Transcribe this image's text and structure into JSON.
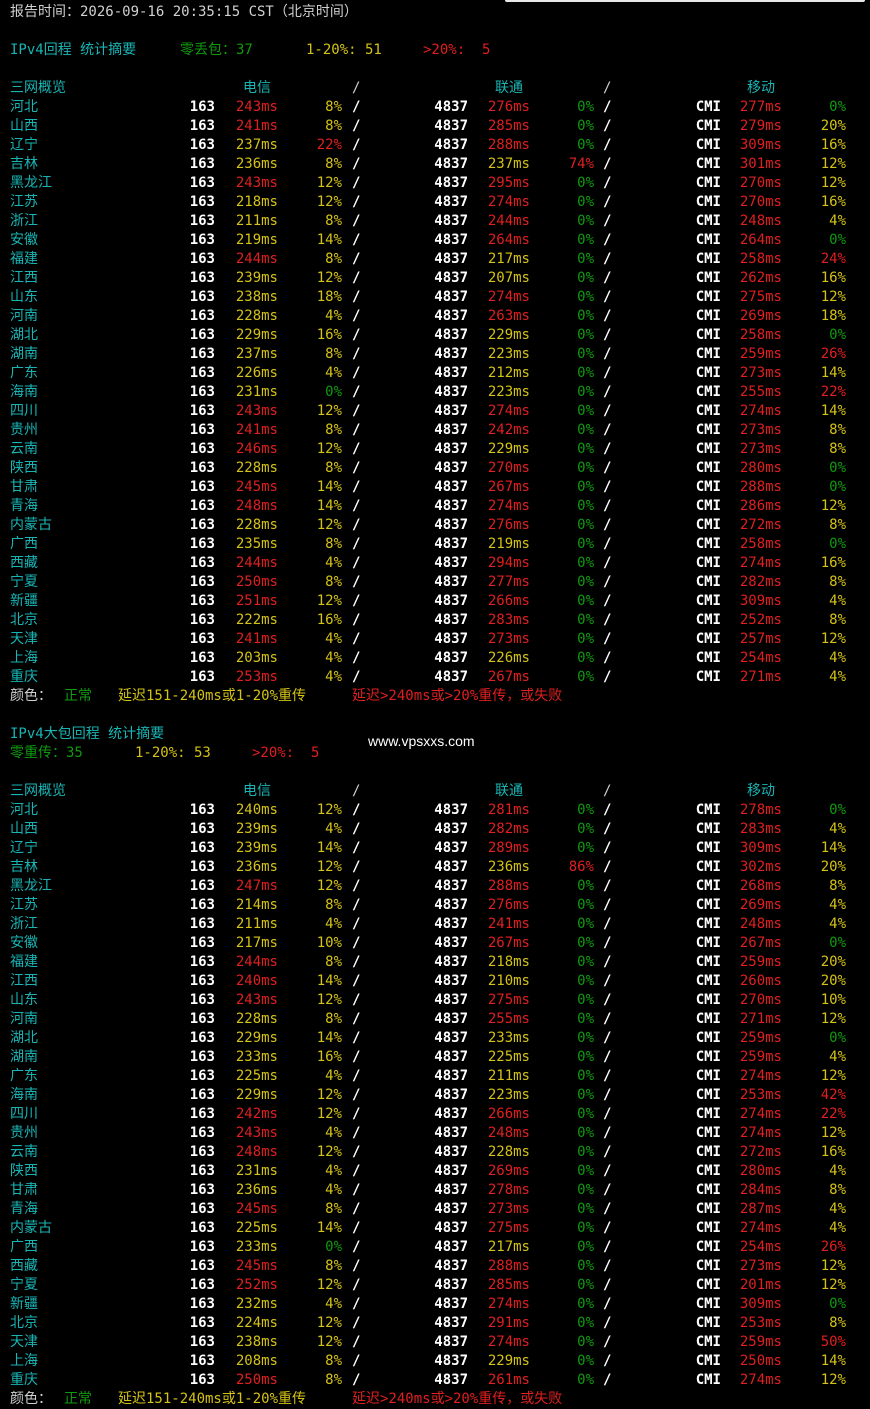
{
  "report_time": "报告时间：2026-09-16 20:35:15 CST（北京时间）",
  "watermark": "www.vpsxxs.com",
  "sections": [
    {
      "title": "IPv4回程 统计摘要",
      "summary": [
        {
          "text": "零丢包：37",
          "color": "green"
        },
        {
          "text": "1-20%: 51",
          "color": "yellow"
        },
        {
          "text": ">20%:  5",
          "color": "red"
        }
      ],
      "header": {
        "name": "三网概览",
        "ct": "电信",
        "cu": "联通",
        "cm": "移动",
        "sep": "/"
      },
      "rows": [
        [
          "河北",
          "163",
          "243ms",
          "r",
          "8%",
          "y",
          "4837",
          "276ms",
          "r",
          "0%",
          "g",
          "CMI",
          "277ms",
          "r",
          "0%",
          "g"
        ],
        [
          "山西",
          "163",
          "241ms",
          "r",
          "8%",
          "y",
          "4837",
          "285ms",
          "r",
          "0%",
          "g",
          "CMI",
          "279ms",
          "r",
          "20%",
          "y"
        ],
        [
          "辽宁",
          "163",
          "237ms",
          "y",
          "22%",
          "r",
          "4837",
          "288ms",
          "r",
          "0%",
          "g",
          "CMI",
          "309ms",
          "r",
          "16%",
          "y"
        ],
        [
          "吉林",
          "163",
          "236ms",
          "y",
          "8%",
          "y",
          "4837",
          "237ms",
          "y",
          "74%",
          "r",
          "CMI",
          "301ms",
          "r",
          "12%",
          "y"
        ],
        [
          "黑龙江",
          "163",
          "243ms",
          "r",
          "12%",
          "y",
          "4837",
          "295ms",
          "r",
          "0%",
          "g",
          "CMI",
          "270ms",
          "r",
          "12%",
          "y"
        ],
        [
          "江苏",
          "163",
          "218ms",
          "y",
          "12%",
          "y",
          "4837",
          "274ms",
          "r",
          "0%",
          "g",
          "CMI",
          "270ms",
          "r",
          "16%",
          "y"
        ],
        [
          "浙江",
          "163",
          "211ms",
          "y",
          "8%",
          "y",
          "4837",
          "244ms",
          "r",
          "0%",
          "g",
          "CMI",
          "248ms",
          "r",
          "4%",
          "y"
        ],
        [
          "安徽",
          "163",
          "219ms",
          "y",
          "14%",
          "y",
          "4837",
          "264ms",
          "r",
          "0%",
          "g",
          "CMI",
          "264ms",
          "r",
          "0%",
          "g"
        ],
        [
          "福建",
          "163",
          "244ms",
          "r",
          "8%",
          "y",
          "4837",
          "217ms",
          "y",
          "0%",
          "g",
          "CMI",
          "258ms",
          "r",
          "24%",
          "r"
        ],
        [
          "江西",
          "163",
          "239ms",
          "y",
          "12%",
          "y",
          "4837",
          "207ms",
          "y",
          "0%",
          "g",
          "CMI",
          "262ms",
          "r",
          "16%",
          "y"
        ],
        [
          "山东",
          "163",
          "238ms",
          "y",
          "18%",
          "y",
          "4837",
          "274ms",
          "r",
          "0%",
          "g",
          "CMI",
          "275ms",
          "r",
          "12%",
          "y"
        ],
        [
          "河南",
          "163",
          "228ms",
          "y",
          "4%",
          "y",
          "4837",
          "263ms",
          "r",
          "0%",
          "g",
          "CMI",
          "269ms",
          "r",
          "18%",
          "y"
        ],
        [
          "湖北",
          "163",
          "229ms",
          "y",
          "16%",
          "y",
          "4837",
          "229ms",
          "y",
          "0%",
          "g",
          "CMI",
          "258ms",
          "r",
          "0%",
          "g"
        ],
        [
          "湖南",
          "163",
          "237ms",
          "y",
          "8%",
          "y",
          "4837",
          "223ms",
          "y",
          "0%",
          "g",
          "CMI",
          "259ms",
          "r",
          "26%",
          "r"
        ],
        [
          "广东",
          "163",
          "226ms",
          "y",
          "4%",
          "y",
          "4837",
          "212ms",
          "y",
          "0%",
          "g",
          "CMI",
          "273ms",
          "r",
          "14%",
          "y"
        ],
        [
          "海南",
          "163",
          "231ms",
          "y",
          "0%",
          "g",
          "4837",
          "223ms",
          "y",
          "0%",
          "g",
          "CMI",
          "255ms",
          "r",
          "22%",
          "r"
        ],
        [
          "四川",
          "163",
          "243ms",
          "r",
          "12%",
          "y",
          "4837",
          "274ms",
          "r",
          "0%",
          "g",
          "CMI",
          "274ms",
          "r",
          "14%",
          "y"
        ],
        [
          "贵州",
          "163",
          "241ms",
          "r",
          "8%",
          "y",
          "4837",
          "242ms",
          "r",
          "0%",
          "g",
          "CMI",
          "273ms",
          "r",
          "8%",
          "y"
        ],
        [
          "云南",
          "163",
          "246ms",
          "r",
          "12%",
          "y",
          "4837",
          "229ms",
          "y",
          "0%",
          "g",
          "CMI",
          "273ms",
          "r",
          "8%",
          "y"
        ],
        [
          "陕西",
          "163",
          "228ms",
          "y",
          "8%",
          "y",
          "4837",
          "270ms",
          "r",
          "0%",
          "g",
          "CMI",
          "280ms",
          "r",
          "0%",
          "g"
        ],
        [
          "甘肃",
          "163",
          "245ms",
          "r",
          "14%",
          "y",
          "4837",
          "267ms",
          "r",
          "0%",
          "g",
          "CMI",
          "288ms",
          "r",
          "0%",
          "g"
        ],
        [
          "青海",
          "163",
          "248ms",
          "r",
          "14%",
          "y",
          "4837",
          "274ms",
          "r",
          "0%",
          "g",
          "CMI",
          "286ms",
          "r",
          "12%",
          "y"
        ],
        [
          "内蒙古",
          "163",
          "228ms",
          "y",
          "12%",
          "y",
          "4837",
          "276ms",
          "r",
          "0%",
          "g",
          "CMI",
          "272ms",
          "r",
          "8%",
          "y"
        ],
        [
          "广西",
          "163",
          "235ms",
          "y",
          "8%",
          "y",
          "4837",
          "219ms",
          "y",
          "0%",
          "g",
          "CMI",
          "258ms",
          "r",
          "0%",
          "g"
        ],
        [
          "西藏",
          "163",
          "244ms",
          "r",
          "4%",
          "y",
          "4837",
          "294ms",
          "r",
          "0%",
          "g",
          "CMI",
          "274ms",
          "r",
          "16%",
          "y"
        ],
        [
          "宁夏",
          "163",
          "250ms",
          "r",
          "8%",
          "y",
          "4837",
          "277ms",
          "r",
          "0%",
          "g",
          "CMI",
          "282ms",
          "r",
          "8%",
          "y"
        ],
        [
          "新疆",
          "163",
          "251ms",
          "r",
          "12%",
          "y",
          "4837",
          "266ms",
          "r",
          "0%",
          "g",
          "CMI",
          "309ms",
          "r",
          "4%",
          "y"
        ],
        [
          "北京",
          "163",
          "222ms",
          "y",
          "16%",
          "y",
          "4837",
          "283ms",
          "r",
          "0%",
          "g",
          "CMI",
          "252ms",
          "r",
          "8%",
          "y"
        ],
        [
          "天津",
          "163",
          "241ms",
          "r",
          "4%",
          "y",
          "4837",
          "273ms",
          "r",
          "0%",
          "g",
          "CMI",
          "257ms",
          "r",
          "12%",
          "y"
        ],
        [
          "上海",
          "163",
          "203ms",
          "y",
          "4%",
          "y",
          "4837",
          "226ms",
          "y",
          "0%",
          "g",
          "CMI",
          "254ms",
          "r",
          "4%",
          "y"
        ],
        [
          "重庆",
          "163",
          "253ms",
          "r",
          "4%",
          "y",
          "4837",
          "267ms",
          "r",
          "0%",
          "g",
          "CMI",
          "271ms",
          "r",
          "4%",
          "y"
        ]
      ],
      "legend": {
        "label": "颜色：",
        "normal": "正常",
        "mid": "延迟151-240ms或1-20%重传",
        "bad": "延迟>240ms或>20%重传，或失败"
      }
    },
    {
      "title": "IPv4大包回程 统计摘要",
      "summary": [
        {
          "text": "零重传：35",
          "color": "green"
        },
        {
          "text": "1-20%: 53",
          "color": "yellow"
        },
        {
          "text": ">20%:  5",
          "color": "red"
        }
      ],
      "header": {
        "name": "三网概览",
        "ct": "电信",
        "cu": "联通",
        "cm": "移动",
        "sep": "/"
      },
      "rows": [
        [
          "河北",
          "163",
          "240ms",
          "y",
          "12%",
          "y",
          "4837",
          "281ms",
          "r",
          "0%",
          "g",
          "CMI",
          "278ms",
          "r",
          "0%",
          "g"
        ],
        [
          "山西",
          "163",
          "239ms",
          "y",
          "4%",
          "y",
          "4837",
          "282ms",
          "r",
          "0%",
          "g",
          "CMI",
          "283ms",
          "r",
          "4%",
          "y"
        ],
        [
          "辽宁",
          "163",
          "239ms",
          "y",
          "14%",
          "y",
          "4837",
          "289ms",
          "r",
          "0%",
          "g",
          "CMI",
          "309ms",
          "r",
          "14%",
          "y"
        ],
        [
          "吉林",
          "163",
          "236ms",
          "y",
          "12%",
          "y",
          "4837",
          "236ms",
          "y",
          "86%",
          "r",
          "CMI",
          "302ms",
          "r",
          "20%",
          "y"
        ],
        [
          "黑龙江",
          "163",
          "247ms",
          "r",
          "12%",
          "y",
          "4837",
          "288ms",
          "r",
          "0%",
          "g",
          "CMI",
          "268ms",
          "r",
          "8%",
          "y"
        ],
        [
          "江苏",
          "163",
          "214ms",
          "y",
          "8%",
          "y",
          "4837",
          "276ms",
          "r",
          "0%",
          "g",
          "CMI",
          "269ms",
          "r",
          "4%",
          "y"
        ],
        [
          "浙江",
          "163",
          "211ms",
          "y",
          "4%",
          "y",
          "4837",
          "241ms",
          "r",
          "0%",
          "g",
          "CMI",
          "248ms",
          "r",
          "4%",
          "y"
        ],
        [
          "安徽",
          "163",
          "217ms",
          "y",
          "10%",
          "y",
          "4837",
          "267ms",
          "r",
          "0%",
          "g",
          "CMI",
          "267ms",
          "r",
          "0%",
          "g"
        ],
        [
          "福建",
          "163",
          "244ms",
          "r",
          "8%",
          "y",
          "4837",
          "218ms",
          "y",
          "0%",
          "g",
          "CMI",
          "259ms",
          "r",
          "20%",
          "y"
        ],
        [
          "江西",
          "163",
          "240ms",
          "r",
          "14%",
          "y",
          "4837",
          "210ms",
          "y",
          "0%",
          "g",
          "CMI",
          "260ms",
          "r",
          "20%",
          "y"
        ],
        [
          "山东",
          "163",
          "243ms",
          "r",
          "12%",
          "y",
          "4837",
          "275ms",
          "r",
          "0%",
          "g",
          "CMI",
          "270ms",
          "r",
          "10%",
          "y"
        ],
        [
          "河南",
          "163",
          "228ms",
          "y",
          "8%",
          "y",
          "4837",
          "255ms",
          "r",
          "0%",
          "g",
          "CMI",
          "271ms",
          "r",
          "12%",
          "y"
        ],
        [
          "湖北",
          "163",
          "229ms",
          "y",
          "14%",
          "y",
          "4837",
          "233ms",
          "y",
          "0%",
          "g",
          "CMI",
          "259ms",
          "r",
          "0%",
          "g"
        ],
        [
          "湖南",
          "163",
          "233ms",
          "y",
          "16%",
          "y",
          "4837",
          "225ms",
          "y",
          "0%",
          "g",
          "CMI",
          "259ms",
          "r",
          "4%",
          "y"
        ],
        [
          "广东",
          "163",
          "225ms",
          "y",
          "4%",
          "y",
          "4837",
          "211ms",
          "y",
          "0%",
          "g",
          "CMI",
          "274ms",
          "r",
          "12%",
          "y"
        ],
        [
          "海南",
          "163",
          "229ms",
          "y",
          "12%",
          "y",
          "4837",
          "223ms",
          "y",
          "0%",
          "g",
          "CMI",
          "253ms",
          "r",
          "42%",
          "r"
        ],
        [
          "四川",
          "163",
          "242ms",
          "r",
          "12%",
          "y",
          "4837",
          "266ms",
          "r",
          "0%",
          "g",
          "CMI",
          "274ms",
          "r",
          "22%",
          "r"
        ],
        [
          "贵州",
          "163",
          "243ms",
          "r",
          "4%",
          "y",
          "4837",
          "248ms",
          "r",
          "0%",
          "g",
          "CMI",
          "274ms",
          "r",
          "12%",
          "y"
        ],
        [
          "云南",
          "163",
          "248ms",
          "r",
          "12%",
          "y",
          "4837",
          "228ms",
          "y",
          "0%",
          "g",
          "CMI",
          "272ms",
          "r",
          "16%",
          "y"
        ],
        [
          "陕西",
          "163",
          "231ms",
          "y",
          "4%",
          "y",
          "4837",
          "269ms",
          "r",
          "0%",
          "g",
          "CMI",
          "280ms",
          "r",
          "4%",
          "y"
        ],
        [
          "甘肃",
          "163",
          "236ms",
          "y",
          "4%",
          "y",
          "4837",
          "278ms",
          "r",
          "0%",
          "g",
          "CMI",
          "284ms",
          "r",
          "8%",
          "y"
        ],
        [
          "青海",
          "163",
          "245ms",
          "r",
          "8%",
          "y",
          "4837",
          "273ms",
          "r",
          "0%",
          "g",
          "CMI",
          "287ms",
          "r",
          "4%",
          "y"
        ],
        [
          "内蒙古",
          "163",
          "225ms",
          "y",
          "14%",
          "y",
          "4837",
          "275ms",
          "r",
          "0%",
          "g",
          "CMI",
          "274ms",
          "r",
          "4%",
          "y"
        ],
        [
          "广西",
          "163",
          "233ms",
          "y",
          "0%",
          "g",
          "4837",
          "217ms",
          "y",
          "0%",
          "g",
          "CMI",
          "254ms",
          "r",
          "26%",
          "r"
        ],
        [
          "西藏",
          "163",
          "245ms",
          "r",
          "8%",
          "y",
          "4837",
          "288ms",
          "r",
          "0%",
          "g",
          "CMI",
          "273ms",
          "r",
          "12%",
          "y"
        ],
        [
          "宁夏",
          "163",
          "252ms",
          "r",
          "12%",
          "y",
          "4837",
          "285ms",
          "r",
          "0%",
          "g",
          "CMI",
          "201ms",
          "r",
          "12%",
          "y"
        ],
        [
          "新疆",
          "163",
          "232ms",
          "y",
          "4%",
          "y",
          "4837",
          "274ms",
          "r",
          "0%",
          "g",
          "CMI",
          "309ms",
          "r",
          "0%",
          "g"
        ],
        [
          "北京",
          "163",
          "224ms",
          "y",
          "12%",
          "y",
          "4837",
          "291ms",
          "r",
          "0%",
          "g",
          "CMI",
          "253ms",
          "r",
          "8%",
          "y"
        ],
        [
          "天津",
          "163",
          "238ms",
          "y",
          "12%",
          "y",
          "4837",
          "274ms",
          "r",
          "0%",
          "g",
          "CMI",
          "259ms",
          "r",
          "50%",
          "r"
        ],
        [
          "上海",
          "163",
          "208ms",
          "y",
          "8%",
          "y",
          "4837",
          "229ms",
          "y",
          "0%",
          "g",
          "CMI",
          "250ms",
          "r",
          "14%",
          "y"
        ],
        [
          "重庆",
          "163",
          "250ms",
          "r",
          "8%",
          "y",
          "4837",
          "261ms",
          "r",
          "0%",
          "g",
          "CMI",
          "274ms",
          "r",
          "12%",
          "y"
        ]
      ],
      "legend": {
        "label": "颜色：",
        "normal": "正常",
        "mid": "延迟151-240ms或1-20%重传",
        "bad": "延迟>240ms或>20%重传，或失败"
      }
    }
  ]
}
